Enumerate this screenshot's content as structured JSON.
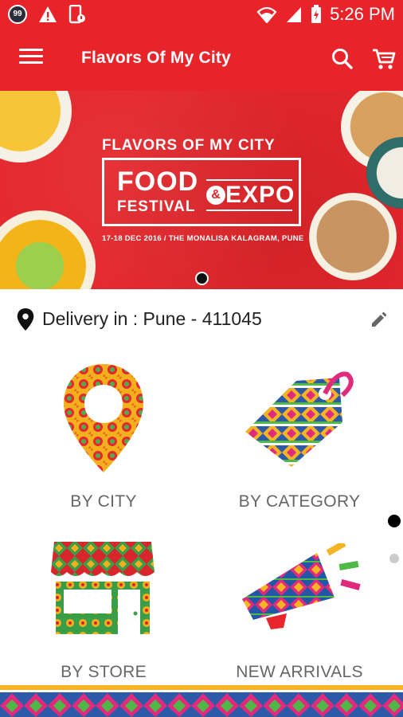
{
  "status_bar": {
    "time": "5:26 PM",
    "notification_badge": "99"
  },
  "app_bar": {
    "title": "Flavors Of My City"
  },
  "banner": {
    "headline": "FLAVORS OF MY CITY",
    "food": "FOOD",
    "festival": "FESTIVAL",
    "ampersand": "&",
    "expo": "EXPO",
    "subline": "17-18 DEC 2016 / THE MONALISA KALAGRAM, PUNE"
  },
  "delivery": {
    "text": "Delivery in : Pune - 411045"
  },
  "tiles": [
    {
      "label": "BY CITY",
      "icon": "city-pin-icon"
    },
    {
      "label": "BY CATEGORY",
      "icon": "category-tag-icon"
    },
    {
      "label": "BY STORE",
      "icon": "store-icon"
    },
    {
      "label": "NEW ARRIVALS",
      "icon": "megaphone-icon"
    }
  ],
  "colors": {
    "brand_red": "#e8232a",
    "label_gray": "#666666"
  }
}
